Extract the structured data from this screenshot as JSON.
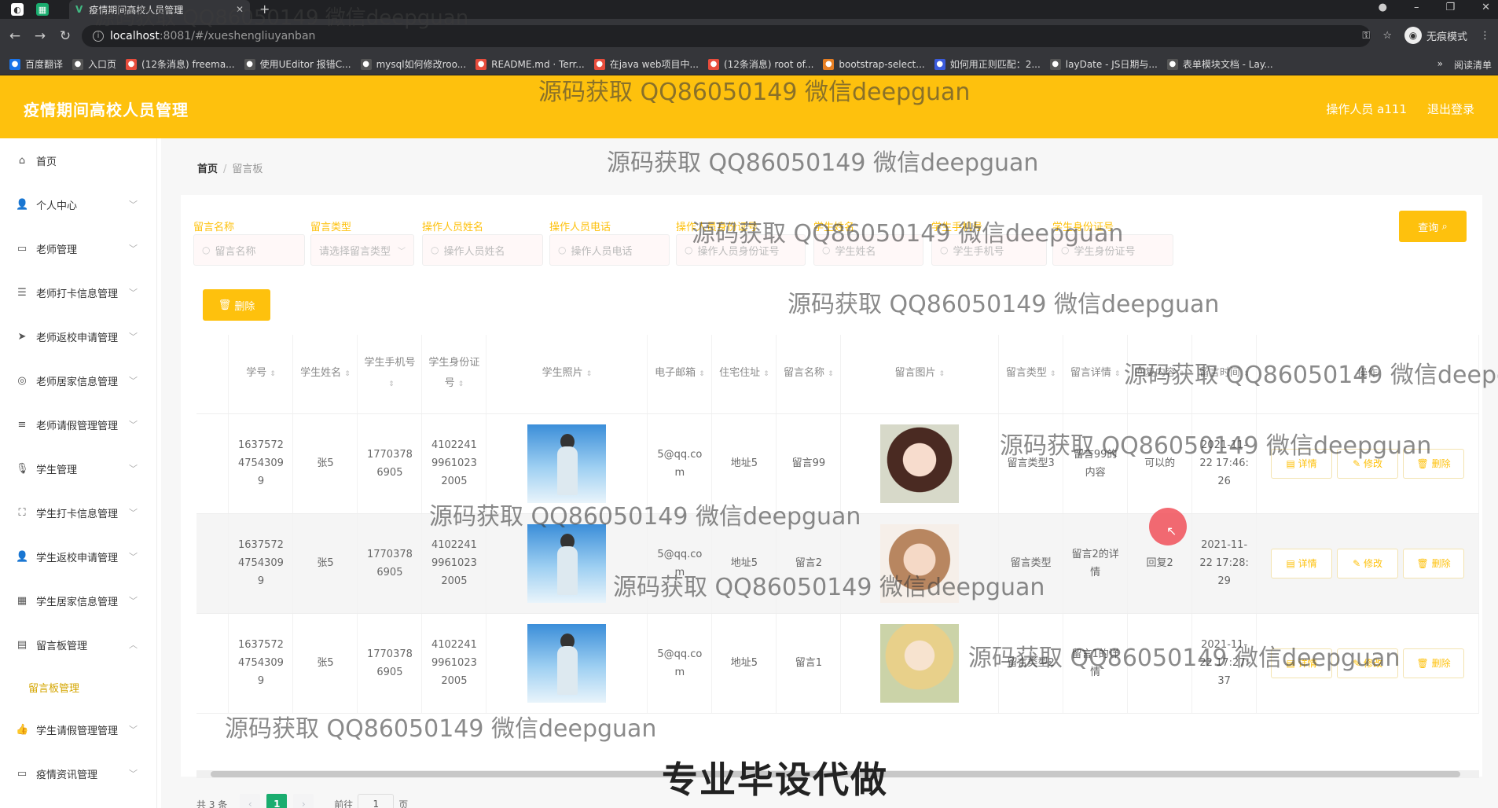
{
  "browser": {
    "tab_title": "疫情期间高校人员管理",
    "url_host": "localhost",
    "url_path": ":8081/#/xueshengliuyanban",
    "incognito_label": "无痕模式",
    "bookmarks": [
      "百度翻译",
      "入口页",
      "(12条消息) freema...",
      "使用UEditor 报错C...",
      "mysql如何修改roo...",
      "README.md · Terr...",
      "在java web项目中...",
      "(12条消息) root of...",
      "bootstrap-select...",
      "如何用正则匹配：2...",
      "layDate - JS日期与...",
      "表单模块文档 - Lay..."
    ],
    "reading_list": "阅读清单"
  },
  "header": {
    "title": "疫情期间高校人员管理",
    "operator": "操作人员 a111",
    "logout": "退出登录"
  },
  "sidebar": {
    "items": [
      {
        "label": "首页",
        "icon": "home-icon"
      },
      {
        "label": "个人中心",
        "icon": "user-icon"
      },
      {
        "label": "老师管理",
        "icon": "monitor-icon"
      },
      {
        "label": "老师打卡信息管理",
        "icon": "sliders-icon"
      },
      {
        "label": "老师返校申请管理",
        "icon": "send-icon"
      },
      {
        "label": "老师居家信息管理",
        "icon": "globe-icon"
      },
      {
        "label": "老师请假管理管理",
        "icon": "list-icon"
      },
      {
        "label": "学生管理",
        "icon": "mic-icon"
      },
      {
        "label": "学生打卡信息管理",
        "icon": "frame-icon"
      },
      {
        "label": "学生返校申请管理",
        "icon": "user-icon"
      },
      {
        "label": "学生居家信息管理",
        "icon": "grid-icon"
      },
      {
        "label": "留言板管理",
        "icon": "board-icon"
      }
    ],
    "sub_active": "留言板管理",
    "items_after": [
      {
        "label": "学生请假管理管理",
        "icon": "thumb-icon"
      },
      {
        "label": "疫情资讯管理",
        "icon": "monitor-icon"
      }
    ]
  },
  "breadcrumb": {
    "home": "首页",
    "current": "留言板"
  },
  "filters": [
    {
      "label": "留言名称",
      "placeholder": "留言名称"
    },
    {
      "label": "留言类型",
      "placeholder": "请选择留言类型"
    },
    {
      "label": "操作人员姓名",
      "placeholder": "操作人员姓名"
    },
    {
      "label": "操作人员电话",
      "placeholder": "操作人员电话"
    },
    {
      "label": "操作人员身份证号",
      "placeholder": "操作人员身份证号"
    },
    {
      "label": "学生姓名",
      "placeholder": "学生姓名"
    },
    {
      "label": "学生手机号",
      "placeholder": "学生手机号"
    },
    {
      "label": "学生身份证号",
      "placeholder": "学生身份证号"
    }
  ],
  "buttons": {
    "query": "查询",
    "delete": "删除",
    "detail": "详情",
    "edit": "修改",
    "remove": "删除"
  },
  "table": {
    "headers": [
      "学号",
      "学生姓名",
      "学生手机号",
      "学生身份证号",
      "学生照片",
      "电子邮箱",
      "住宅住址",
      "留言名称",
      "留言图片",
      "留言类型",
      "留言详情",
      "回复内容",
      "留言时间",
      "操作"
    ],
    "rows": [
      {
        "id": "16375724754309 9",
        "name": "张5",
        "phone": "17703786905",
        "idcard": "410224199610232005",
        "email": "5@qq.com",
        "address": "地址5",
        "msg_name": "留言99",
        "msg_type": "留言类型3",
        "msg_detail": "留言99的内容",
        "reply": "可以的",
        "time": "2021-11-22 17:46:26"
      },
      {
        "id": "16375724754309 9",
        "name": "张5",
        "phone": "17703786905",
        "idcard": "410224199610232005",
        "email": "5@qq.com",
        "address": "地址5",
        "msg_name": "留言2",
        "msg_type": "留言类型",
        "msg_detail": "留言2的详情",
        "reply": "回复2",
        "time": "2021-11-22 17:28:29"
      },
      {
        "id": "16375724754309 9",
        "name": "张5",
        "phone": "17703786905",
        "idcard": "410224199610232005",
        "email": "5@qq.com",
        "address": "地址5",
        "msg_name": "留言1",
        "msg_type": "留言类型2",
        "msg_detail": "留言1的详情",
        "reply": "",
        "time": "2021-11-22 17:27:37"
      }
    ]
  },
  "pagination": {
    "total": "共 3 条",
    "page": "1",
    "goto_label": "前往",
    "goto_value": "1",
    "page_suffix": "页"
  },
  "watermark": "源码获取 QQ86050149 微信deepguan",
  "banner": "专业毕设代做"
}
